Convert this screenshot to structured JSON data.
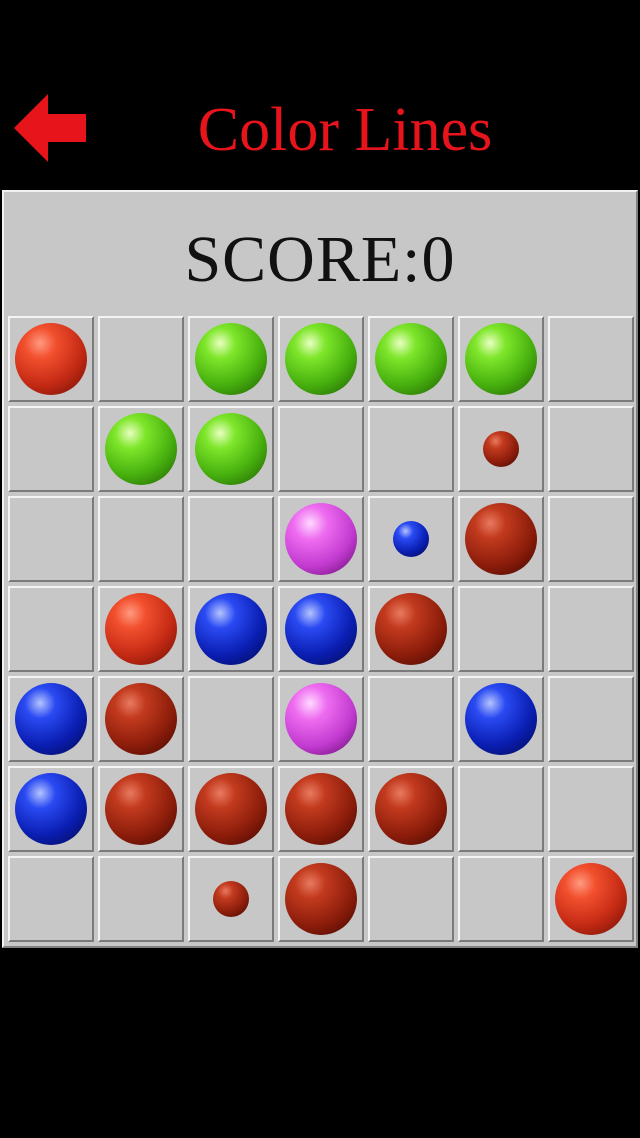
{
  "header": {
    "title": "Color Lines",
    "back_icon": "back-arrow-icon",
    "back_color": "#e8141c"
  },
  "score": {
    "text": "SCORE:0"
  },
  "board": {
    "rows": 7,
    "cols": 7,
    "colors": {
      "red-bright": "#f2502e",
      "red-dark": "#a52a12",
      "green": "#6ad61e",
      "blue": "#1432d2",
      "magenta": "#dc5ae0"
    },
    "cells": [
      [
        {
          "color": "red-bright",
          "size": "big"
        },
        null,
        {
          "color": "green",
          "size": "big"
        },
        {
          "color": "green",
          "size": "big"
        },
        {
          "color": "green",
          "size": "big"
        },
        {
          "color": "green",
          "size": "big"
        },
        null
      ],
      [
        null,
        {
          "color": "green",
          "size": "big"
        },
        {
          "color": "green",
          "size": "big"
        },
        null,
        null,
        {
          "color": "red-dark",
          "size": "small"
        },
        null
      ],
      [
        null,
        null,
        null,
        {
          "color": "magenta",
          "size": "big"
        },
        {
          "color": "blue",
          "size": "small"
        },
        {
          "color": "red-dark",
          "size": "big"
        },
        null
      ],
      [
        null,
        {
          "color": "red-bright",
          "size": "big"
        },
        {
          "color": "blue",
          "size": "big"
        },
        {
          "color": "blue",
          "size": "big"
        },
        {
          "color": "red-dark",
          "size": "big"
        },
        null,
        null
      ],
      [
        {
          "color": "blue",
          "size": "big"
        },
        {
          "color": "red-dark",
          "size": "big"
        },
        null,
        {
          "color": "magenta",
          "size": "big"
        },
        null,
        {
          "color": "blue",
          "size": "big"
        },
        null
      ],
      [
        {
          "color": "blue",
          "size": "big"
        },
        {
          "color": "red-dark",
          "size": "big"
        },
        {
          "color": "red-dark",
          "size": "big"
        },
        {
          "color": "red-dark",
          "size": "big"
        },
        {
          "color": "red-dark",
          "size": "big"
        },
        null,
        null
      ],
      [
        null,
        null,
        {
          "color": "red-dark",
          "size": "small"
        },
        {
          "color": "red-dark",
          "size": "big"
        },
        null,
        null,
        {
          "color": "red-bright",
          "size": "big"
        }
      ]
    ]
  }
}
